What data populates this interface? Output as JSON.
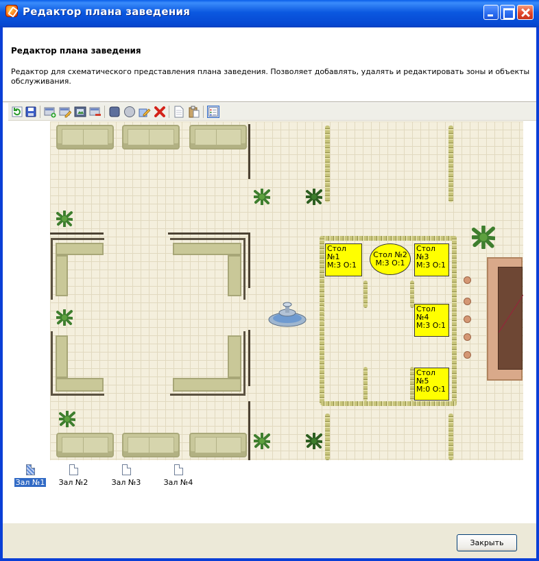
{
  "window": {
    "title": "Редактор плана заведения",
    "controls": {
      "minimize": "minimize",
      "maximize": "maximize",
      "close": "close"
    }
  },
  "header": {
    "title": "Редактор плана заведения",
    "description": "Редактор для схематического представления плана заведения. Позволяет добавлять, удалять и редактировать зоны и объекты обслуживания."
  },
  "toolbar": {
    "items": [
      "refresh-icon",
      "save-icon",
      "add-zone-icon",
      "edit-zone-icon",
      "zone-background-icon",
      "delete-zone-icon",
      "rect-table-icon",
      "round-table-icon",
      "edit-object-icon",
      "delete-object-icon",
      "copy-icon",
      "paste-icon",
      "properties-icon"
    ]
  },
  "tables": [
    {
      "line1": "Стол",
      "line2": "№1",
      "line3": "М:3 О:1"
    },
    {
      "line1": "Стол №2",
      "line2": "М:3 О:1"
    },
    {
      "line1": "Стол",
      "line2": "№3",
      "line3": "М:3 О:1"
    },
    {
      "line1": "Стол",
      "line2": "№4",
      "line3": "М:3 О:1"
    },
    {
      "line1": "Стол",
      "line2": "№5",
      "line3": "М:0 О:1"
    }
  ],
  "halls": [
    {
      "label": "Зал №1",
      "active": true
    },
    {
      "label": "Зал №2",
      "active": false
    },
    {
      "label": "Зал №3",
      "active": false
    },
    {
      "label": "Зал №4",
      "active": false
    }
  ],
  "footer": {
    "close_label": "Закрыть"
  },
  "colors": {
    "titlebar": "#0a58e0",
    "table": "#ffff00",
    "selection": "#316ac5"
  }
}
